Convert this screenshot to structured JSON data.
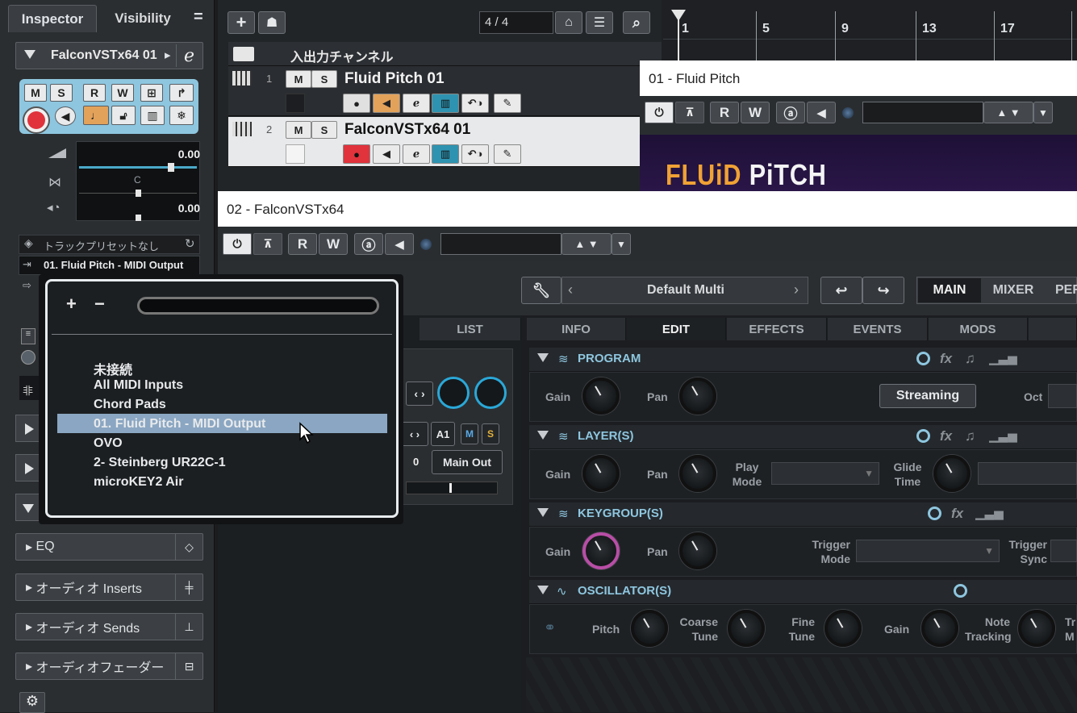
{
  "inspector": {
    "tab_inspector": "Inspector",
    "tab_visibility": "Visibility",
    "track_name": "FalconVSTx64 01",
    "value_volume": "0.00",
    "value_pan": "C",
    "value_delay": "0.00",
    "preset_label": "トラックプリセットなし",
    "midi_output": "01. Fluid Pitch - MIDI Output",
    "partial_label": "非",
    "sections": [
      "EQ",
      "オーディオ Inserts",
      "オーディオ Sends",
      "オーディオフェーダー"
    ]
  },
  "toolbar": {
    "counter": "4 / 4"
  },
  "tracks": {
    "folder_name": "入出力チャンネル",
    "items": [
      {
        "number": "1",
        "name": "Fluid Pitch 01"
      },
      {
        "number": "2",
        "name": "FalconVSTx64 01"
      }
    ]
  },
  "ruler": {
    "marks": [
      "1",
      "5",
      "9",
      "13",
      "17"
    ]
  },
  "window_fluid": {
    "title": "01 - Fluid Pitch",
    "logo_a": "FLUiD",
    "logo_b": "PiTCH"
  },
  "window_falcon": {
    "title": "02 - FalconVSTx64",
    "preset": "Default Multi",
    "main_tabs": [
      "MAIN",
      "MIXER",
      "PER"
    ],
    "list_tab": "LIST",
    "edit_tabs": [
      "INFO",
      "EDIT",
      "EFFECTS",
      "EVENTS",
      "MODS"
    ],
    "a1": "A1",
    "zero": "0",
    "main_out": "Main Out",
    "sections": {
      "program": {
        "title": "PROGRAM",
        "gain": "Gain",
        "pan": "Pan",
        "streaming": "Streaming",
        "oct": "Oct"
      },
      "layer": {
        "title": "LAYER(S)",
        "gain": "Gain",
        "pan": "Pan",
        "play_mode": "Play\nMode",
        "glide_time": "Glide\nTime"
      },
      "keygroup": {
        "title": "KEYGROUP(S)",
        "gain": "Gain",
        "pan": "Pan",
        "trigger_mode": "Trigger\nMode",
        "trigger_sync": "Trigger\nSync"
      },
      "oscillator": {
        "title": "OSCILLATOR(S)",
        "pitch": "Pitch",
        "coarse_tune": "Coarse\nTune",
        "fine_tune": "Fine\nTune",
        "gain": "Gain",
        "note_tracking": "Note\nTracking",
        "partial": "Tr\nM"
      }
    }
  },
  "popup": {
    "plus": "+",
    "minus": "−",
    "items": [
      "未接続",
      "All MIDI Inputs",
      "Chord Pads",
      "01. Fluid Pitch - MIDI Output",
      "OVO",
      "2- Steinberg UR22C-1",
      "microKEY2 Air"
    ],
    "selected_index": 3
  },
  "colors": {
    "accent": "#8ec6df",
    "selected_row": "#8aa6c2",
    "record": "#e0333c",
    "orange": "#e3a25a",
    "cyan": "#2e93b0"
  }
}
